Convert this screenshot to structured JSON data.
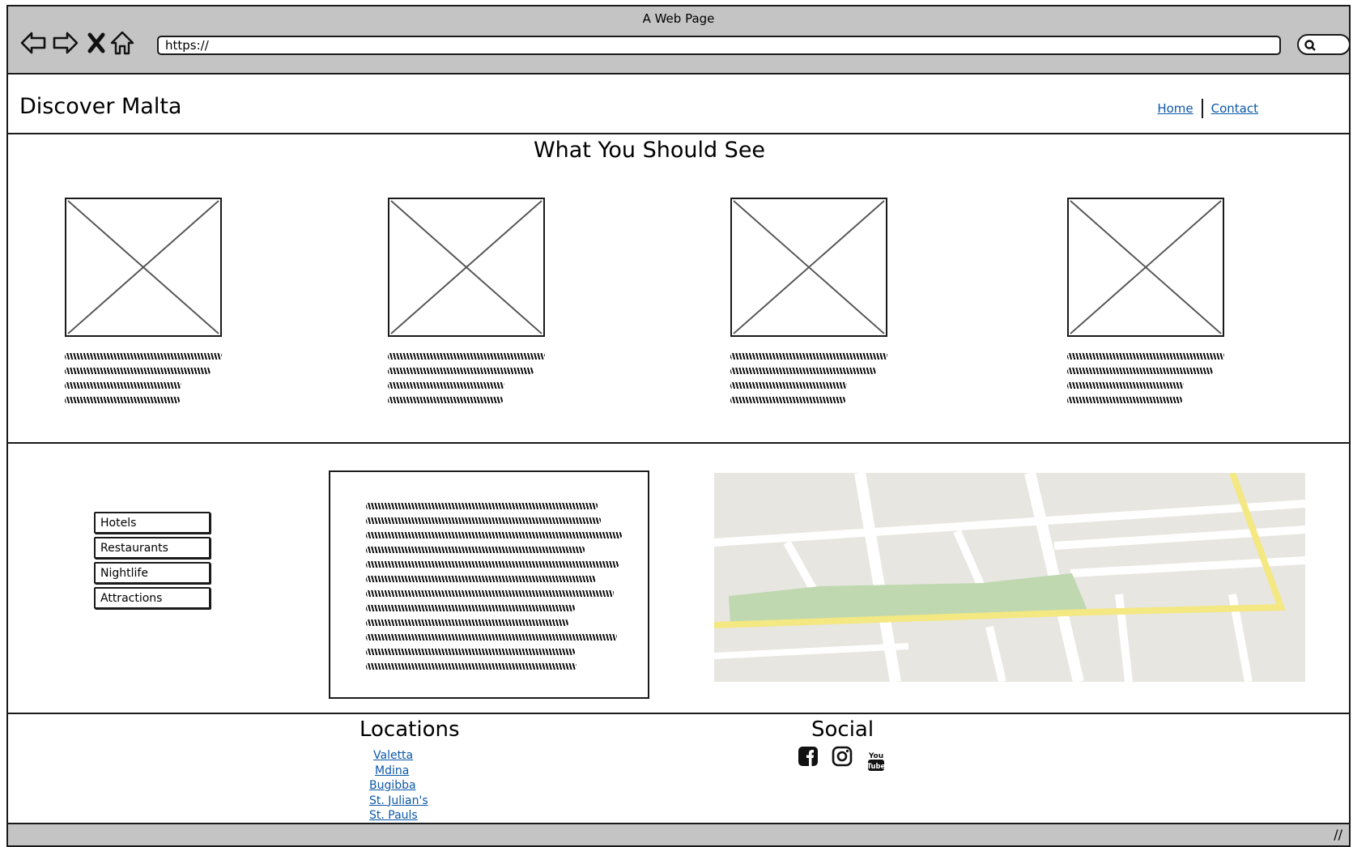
{
  "window": {
    "title": "A Web Page"
  },
  "browser": {
    "url": "https://"
  },
  "header": {
    "site_title": "Discover Malta",
    "nav": [
      {
        "label": "Home"
      },
      {
        "label": "Contact"
      }
    ]
  },
  "main": {
    "heading": "What You Should See"
  },
  "side_menu": {
    "items": [
      {
        "label": "Hotels"
      },
      {
        "label": "Restaurants"
      },
      {
        "label": "Nightlife"
      },
      {
        "label": "Attractions"
      }
    ]
  },
  "footer": {
    "locations_title": "Locations",
    "locations": [
      {
        "label": "Valetta"
      },
      {
        "label": "Mdina"
      },
      {
        "label": "Bugibba"
      },
      {
        "label": "St. Julian's"
      },
      {
        "label": "St. Pauls"
      }
    ],
    "social_title": "Social",
    "social_icons": [
      "facebook-icon",
      "instagram-icon",
      "youtube-icon"
    ]
  },
  "colors": {
    "chrome": "#c4c4c4",
    "link": "#0b57a8",
    "map_road": "#ffffff",
    "map_highway": "#f3e882",
    "map_park": "#bfd8b0"
  }
}
